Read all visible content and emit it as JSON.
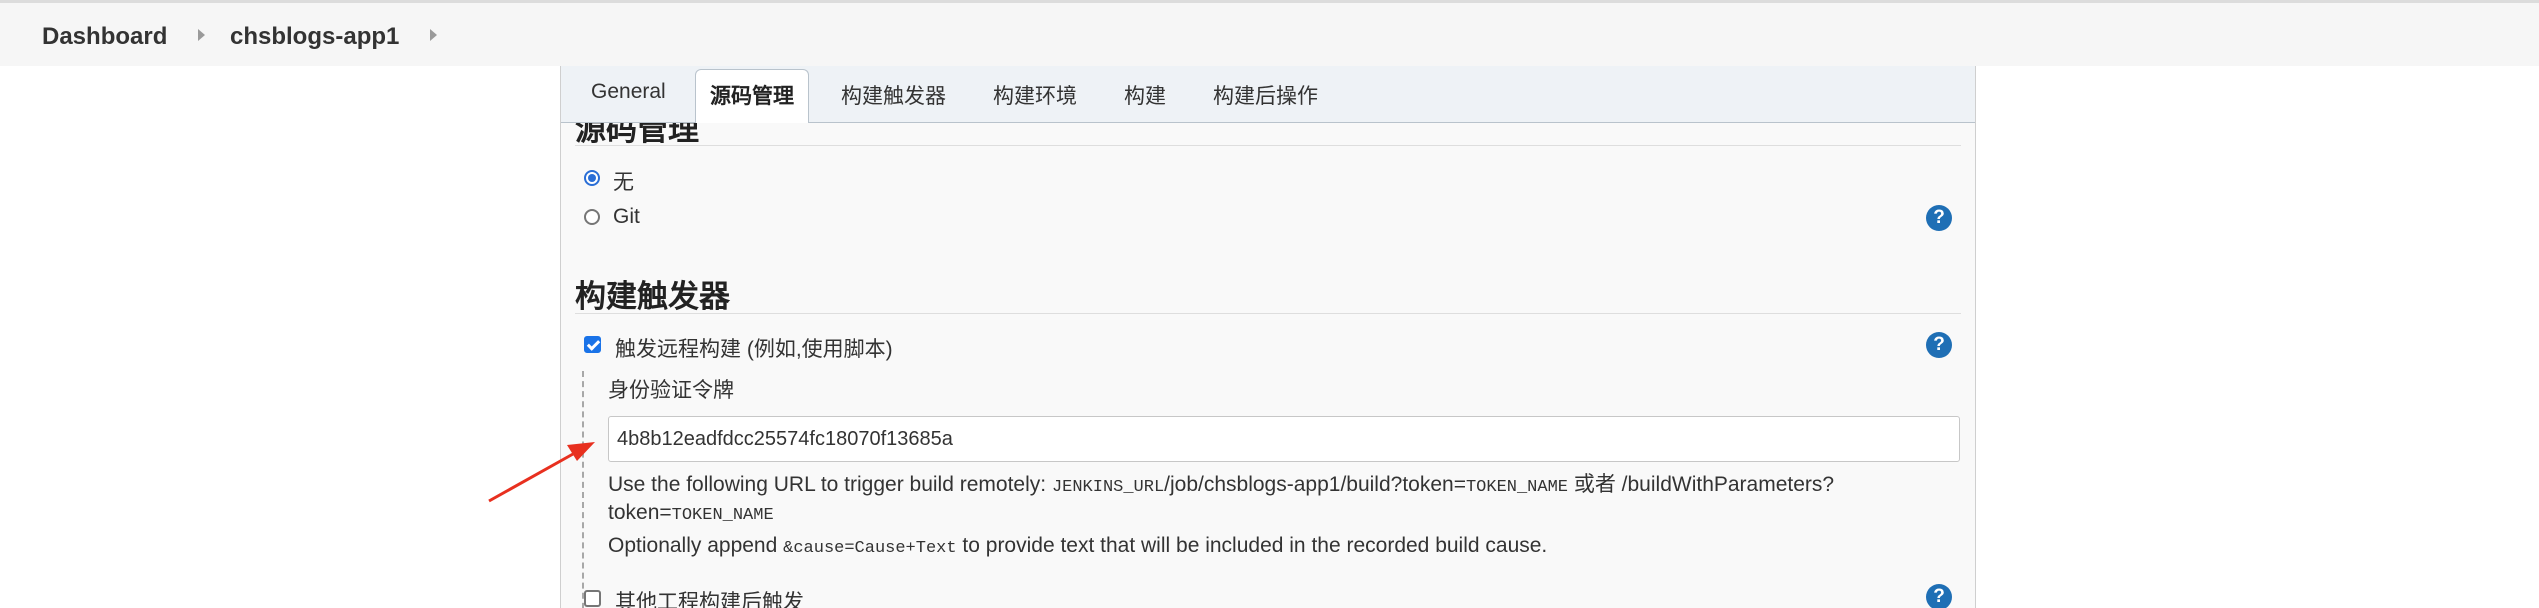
{
  "breadcrumb": {
    "items": [
      "Dashboard",
      "chsblogs-app1"
    ]
  },
  "tabs": [
    {
      "label": "General",
      "active": false
    },
    {
      "label": "源码管理",
      "active": true
    },
    {
      "label": "构建触发器",
      "active": false
    },
    {
      "label": "构建环境",
      "active": false
    },
    {
      "label": "构建",
      "active": false
    },
    {
      "label": "构建后操作",
      "active": false
    }
  ],
  "scm": {
    "title": "源码管理",
    "options": [
      {
        "label": "无",
        "selected": true
      },
      {
        "label": "Git",
        "selected": false
      }
    ]
  },
  "triggers": {
    "title": "构建触发器",
    "remote": {
      "label": "触发远程构建 (例如,使用脚本)",
      "checked": true,
      "token_label": "身份验证令牌",
      "token_value": "4b8b12eadfdcc25574fc18070f13685a",
      "desc_prefix": "Use the following URL to trigger build remotely: ",
      "desc_code1": "JENKINS_URL",
      "desc_mid": "/job/chsblogs-app1/build?token=",
      "desc_code2": "TOKEN_NAME",
      "desc_or": " 或者 /buildWithParameters?",
      "desc_line2_text": "token=",
      "desc_line2_code": "TOKEN_NAME",
      "opt_prefix": "Optionally append ",
      "opt_code": "&cause=Cause+Text",
      "opt_suffix": " to provide text that will be included in the recorded build cause."
    },
    "other": {
      "label": "其他工程构建后触发",
      "checked": false
    }
  },
  "help_glyph": "?",
  "colors": {
    "accent": "#1f6fb5",
    "checkbox": "#1a73e8",
    "arrow": "#e8301f"
  }
}
